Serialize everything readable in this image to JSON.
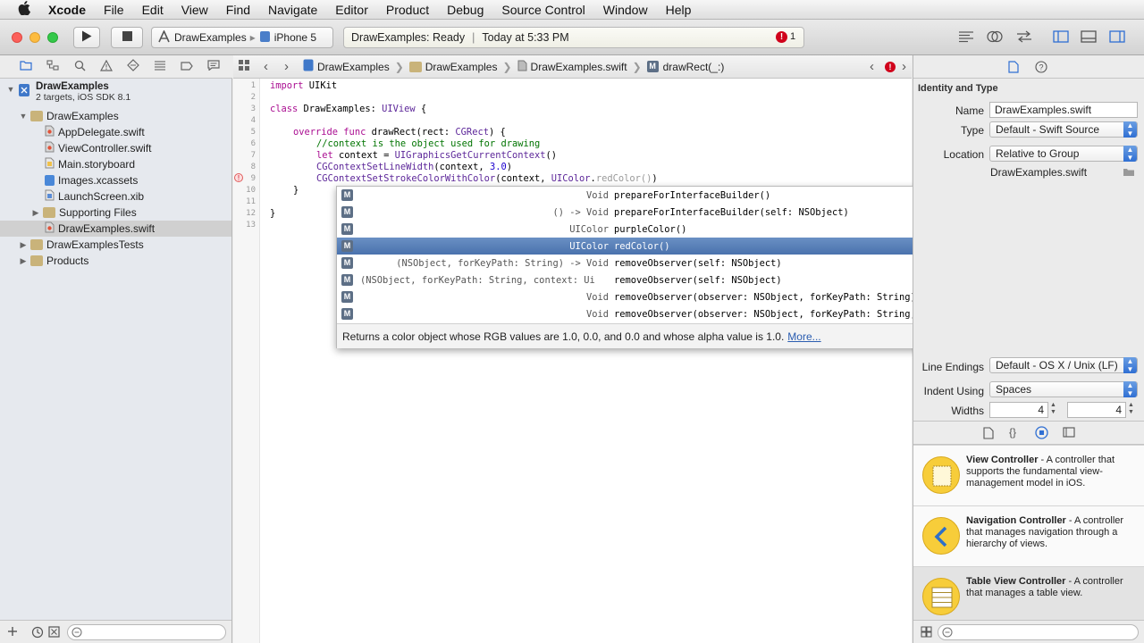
{
  "menubar": {
    "apple": "",
    "items": [
      "Xcode",
      "File",
      "Edit",
      "View",
      "Find",
      "Navigate",
      "Editor",
      "Product",
      "Debug",
      "Source Control",
      "Window",
      "Help"
    ]
  },
  "toolbar": {
    "scheme_project": "DrawExamples",
    "scheme_device": "iPhone 5",
    "activity_status": "DrawExamples: Ready",
    "activity_time": "Today at 5:33 PM",
    "issue_count": "1"
  },
  "navigator": {
    "project": {
      "name": "DrawExamples",
      "subtitle": "2 targets, iOS SDK 8.1"
    },
    "items": [
      {
        "label": "DrawExamples",
        "kind": "folder"
      },
      {
        "label": "AppDelegate.swift",
        "kind": "swift"
      },
      {
        "label": "ViewController.swift",
        "kind": "swift"
      },
      {
        "label": "Main.storyboard",
        "kind": "storyboard"
      },
      {
        "label": "Images.xcassets",
        "kind": "assets"
      },
      {
        "label": "LaunchScreen.xib",
        "kind": "xib"
      },
      {
        "label": "Supporting Files",
        "kind": "folder"
      },
      {
        "label": "DrawExamples.swift",
        "kind": "swift"
      },
      {
        "label": "DrawExamplesTests",
        "kind": "folder"
      },
      {
        "label": "Products",
        "kind": "folder"
      }
    ]
  },
  "jumpbar": {
    "crumbs": [
      "DrawExamples",
      "DrawExamples",
      "DrawExamples.swift",
      "drawRect(_:)"
    ]
  },
  "code": {
    "line_numbers": [
      "1",
      "2",
      "3",
      "4",
      "5",
      "6",
      "7",
      "8",
      "9",
      "10",
      "11",
      "12",
      "13"
    ],
    "l1_kw": "import",
    "l1_rest": " UIKit",
    "l3_kw": "class",
    "l3_name": " DrawExamples: ",
    "l3_type": "UIView",
    "l3_end": " {",
    "l5_kw": "override func",
    "l5_name": " drawRect(rect: ",
    "l5_type": "CGRect",
    "l5_end": ") {",
    "l6": "//context is the object used for drawing",
    "l7_kw": "let",
    "l7_rest": " context = ",
    "l7_fn": "UIGraphicsGetCurrentContext",
    "l7_end": "()",
    "l8_fn": "CGContextSetLineWidth",
    "l8_mid": "(context, ",
    "l8_num": "3.0",
    "l8_end": ")",
    "l9_fn": "CGContextSetStrokeColorWithColor",
    "l9_mid": "(context, ",
    "l9_type": "UIColor",
    "l9_dot": ".",
    "l9_ghost": "redColor()",
    "l9_end": ")",
    "l10": "}",
    "l12": "}"
  },
  "completion": {
    "items": [
      {
        "ret": "Void",
        "name": "prepareForInterfaceBuilder()"
      },
      {
        "ret": "() -> Void",
        "name": "prepareForInterfaceBuilder(self: NSObject)"
      },
      {
        "ret": "UIColor",
        "name": "purpleColor()"
      },
      {
        "ret": "UIColor",
        "name": "redColor()"
      },
      {
        "ret": "(NSObject, forKeyPath: String) -> Void",
        "name": "removeObserver(self: NSObject)"
      },
      {
        "ret": "(NSObject, forKeyPath: String, context: Ui",
        "name": "removeObserver(self: NSObject)"
      },
      {
        "ret": "Void",
        "name": "removeObserver(observer: NSObject, forKeyPath: String)"
      },
      {
        "ret": "Void",
        "name": "removeObserver(observer: NSObject, forKeyPath: String, context: UnsafeMutablePointer<Void>"
      }
    ],
    "selected_index": 3,
    "description": "Returns a color object whose RGB values are 1.0, 0.0, and 0.0 and whose alpha value is 1.0.",
    "more_link": "More..."
  },
  "inspector": {
    "section_title": "Identity and Type",
    "name_label": "Name",
    "name_value": "DrawExamples.swift",
    "type_label": "Type",
    "type_value": "Default - Swift Source",
    "location_label": "Location",
    "location_value": "Relative to Group",
    "location_file": "DrawExamples.swift",
    "line_endings_label": "Line Endings",
    "line_endings_value": "Default - OS X / Unix (LF)",
    "indent_label": "Indent Using",
    "indent_value": "Spaces",
    "widths_label": "Widths",
    "width_tab": "4",
    "width_indent": "4"
  },
  "library": {
    "items": [
      {
        "title": "View Controller",
        "desc": " - A controller that supports the fundamental view-management model in iOS."
      },
      {
        "title": "Navigation Controller",
        "desc": " - A controller that manages navigation through a hierarchy of views."
      },
      {
        "title": "Table View Controller",
        "desc": " - A controller that manages a table view."
      }
    ]
  },
  "colors": {
    "accent": "#2f6fd3",
    "selection": "#4a72ad",
    "keyword": "#aa0d91",
    "type": "#5c2699",
    "comment": "#007400",
    "error": "#d0021b"
  }
}
